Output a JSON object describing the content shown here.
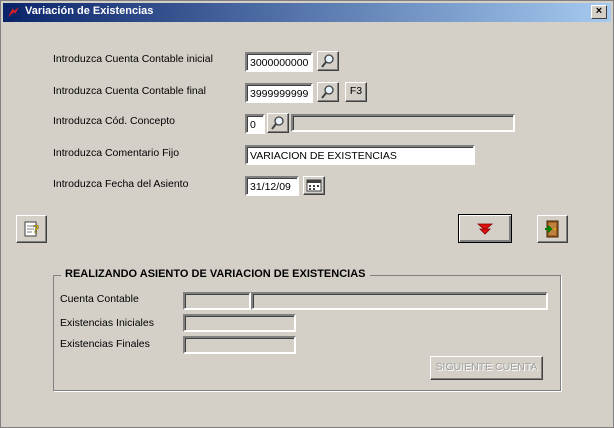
{
  "window": {
    "title": "Variación de Existencias",
    "close_label": "×"
  },
  "form": {
    "cuenta_inicial": {
      "label": "Introduzca Cuenta Contable inicial",
      "value": "3000000000"
    },
    "cuenta_final": {
      "label": "Introduzca Cuenta Contable final",
      "value": "3999999999",
      "f3_label": "F3"
    },
    "concepto": {
      "label": "Introduzca Cód. Concepto",
      "value": "0",
      "description": ""
    },
    "comentario": {
      "label": "Introduzca Comentario Fijo",
      "value": "VARIACION DE EXISTENCIAS"
    },
    "fecha": {
      "label": "Introduzca Fecha del Asiento",
      "value": "31/12/09"
    }
  },
  "group": {
    "title": "REALIZANDO ASIENTO DE VARIACION DE EXISTENCIAS",
    "cuenta_label": "Cuenta Contable",
    "cuenta_code": "",
    "cuenta_name": "",
    "iniciales_label": "Existencias Iniciales",
    "iniciales_value": "",
    "finales_label": "Existencias Finales",
    "finales_value": "",
    "siguiente_label": "SIGUIENTE CUENTA"
  },
  "icons": {
    "help": "help-note-icon",
    "search": "magnifier-icon",
    "calendar": "calendar-icon",
    "execute": "red-down-arrow-icon",
    "exit": "exit-door-icon"
  }
}
